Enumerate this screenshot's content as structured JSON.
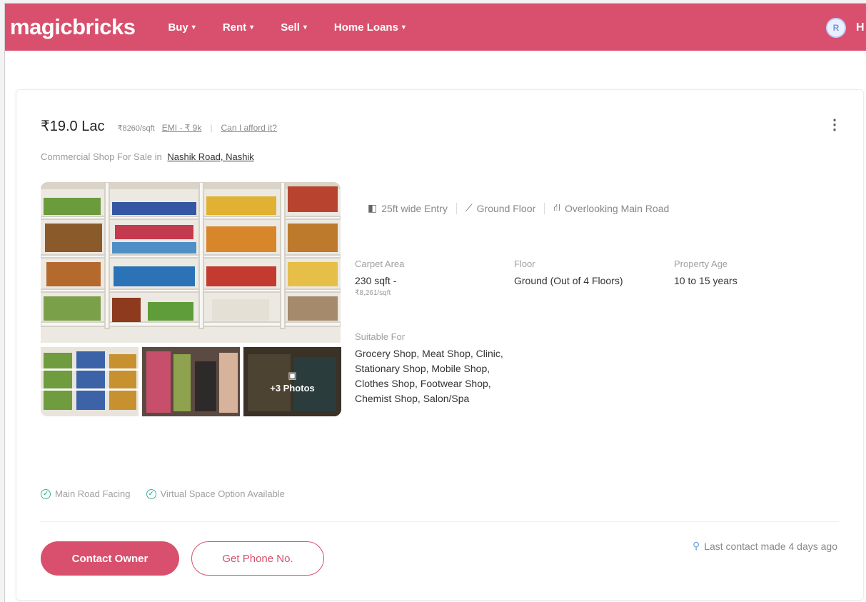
{
  "header": {
    "logo": "magicbricks",
    "nav": [
      {
        "label": "Buy"
      },
      {
        "label": "Rent"
      },
      {
        "label": "Sell"
      },
      {
        "label": "Home Loans"
      }
    ],
    "avatar_letter": "R",
    "user_initial": "H",
    "brand_color": "#d8506d"
  },
  "listing": {
    "price": "₹19.0 Lac",
    "price_per_sqft": "₹8260/sqft",
    "emi": "EMI - ₹ 9k",
    "afford_link": "Can I afford it?",
    "subtitle": "Commercial Shop For Sale in",
    "location": "Nashik Road, Nashik",
    "photos_more": "+3 Photos",
    "highlights": [
      {
        "label": "25ft wide Entry",
        "icon": "door-icon"
      },
      {
        "label": "Ground Floor",
        "icon": "stairs-icon"
      },
      {
        "label": "Overlooking Main Road",
        "icon": "road-icon"
      }
    ],
    "specs": {
      "carpet_area": {
        "label": "Carpet Area",
        "value": "230 sqft -",
        "sub": "₹8,261/sqft"
      },
      "floor": {
        "label": "Floor",
        "value": "Ground (Out of 4 Floors)"
      },
      "property_age": {
        "label": "Property Age",
        "value": "10 to 15 years"
      },
      "suitable_for": {
        "label": "Suitable For",
        "value": "Grocery Shop, Meat Shop, Clinic, Stationary Shop, Mobile Shop, Clothes Shop, Footwear Shop, Chemist Shop, Salon/Spa"
      }
    },
    "features": [
      "Main Road Facing",
      "Virtual Space Option Available"
    ],
    "contact_button": "Contact Owner",
    "phone_button": "Get Phone No.",
    "last_contact": "Last contact made 4 days ago"
  }
}
